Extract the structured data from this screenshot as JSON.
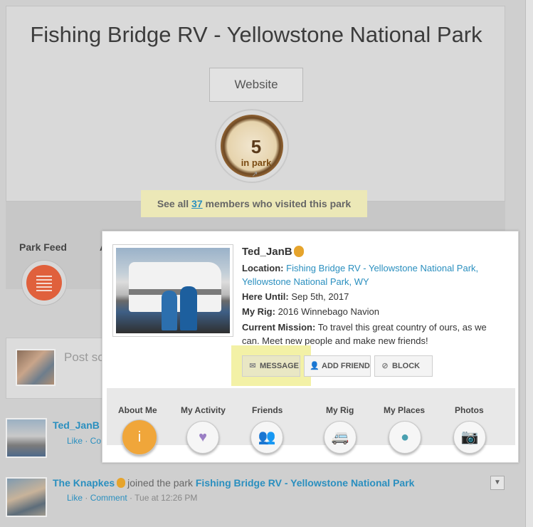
{
  "park": {
    "title": "Fishing Bridge RV - Yellowstone National Park",
    "website_label": "Website",
    "in_park_count": "5",
    "in_park_label": "in park",
    "members_prefix": "See all",
    "members_count": "37",
    "members_suffix": "members who visited this park"
  },
  "tabs": {
    "park_feed_label": "Park Feed",
    "second_tab_partial": "A"
  },
  "post": {
    "placeholder": "Post so"
  },
  "feed": {
    "item1": {
      "name": "Ted_JanB",
      "links": "Like · Co"
    },
    "item2": {
      "name": "The Knapkes",
      "action": "joined the park",
      "park": "Fishing Bridge RV - Yellowstone National Park",
      "like": "Like",
      "sep1": " · ",
      "comment": "Comment",
      "sep2": " · ",
      "time": "Tue at 12:26 PM"
    }
  },
  "profile": {
    "username": "Ted_JanB",
    "location_label": "Location:",
    "location_value": "Fishing Bridge RV - Yellowstone National Park, Yellowstone National Park, WY",
    "here_until_label": "Here Until:",
    "here_until_value": "Sep 5th, 2017",
    "rig_label": "My Rig:",
    "rig_value": "2016 Winnebago Navion",
    "mission_label": "Current Mission:",
    "mission_value": "To travel this great country of ours, as we can. Meet new people and make new friends!",
    "actions": {
      "message": "MESSAGE",
      "add_friend": "ADD FRIEND",
      "block": "BLOCK"
    },
    "nav": [
      {
        "label": "About Me",
        "icon": "info-icon"
      },
      {
        "label": "My Activity",
        "icon": "heart-icon"
      },
      {
        "label": "Friends",
        "icon": "people-icon"
      },
      {
        "label": "My Rig",
        "icon": "rv-icon"
      },
      {
        "label": "My Places",
        "icon": "map-pin-icon"
      },
      {
        "label": "Photos",
        "icon": "camera-icon"
      }
    ]
  },
  "colors": {
    "link": "#2a8fbf",
    "accent_orange": "#f0a63a",
    "feed_button": "#e0603c",
    "highlight": "#f3f1a6"
  }
}
